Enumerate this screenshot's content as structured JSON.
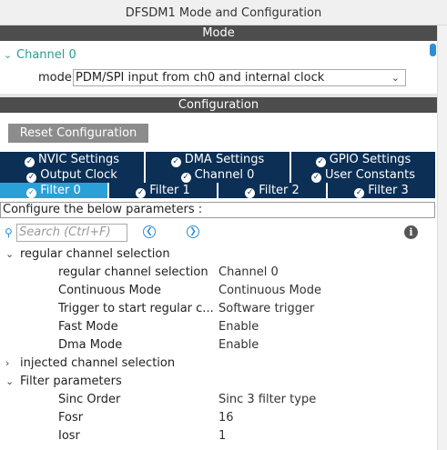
{
  "window": {
    "title": "DFSDM1 Mode and Configuration"
  },
  "mode_section": {
    "header": "Mode",
    "channel_label": "Channel 0",
    "mode_label": "mode",
    "mode_value": "PDM/SPI input from ch0 and internal clock"
  },
  "config_section": {
    "header": "Configuration",
    "reset_button": "Reset Configuration"
  },
  "tabs": {
    "row1": [
      "NVIC Settings",
      "DMA Settings",
      "GPIO Settings"
    ],
    "row2": [
      "Output Clock",
      "Channel 0",
      "User Constants"
    ],
    "row3": [
      "Filter 0",
      "Filter 1",
      "Filter 2",
      "Filter 3"
    ],
    "active": "Filter 0"
  },
  "configure_text": "Configure the below parameters :",
  "search": {
    "placeholder": "Search (Ctrl+F)"
  },
  "icons": {
    "search": "search-icon",
    "prev": "chevron-left-icon",
    "next": "chevron-right-icon",
    "info": "info-icon",
    "check": "check-icon"
  },
  "colors": {
    "tab_bg": "#0b2f55",
    "tab_active": "#2aa0d8",
    "section_bar": "#4d4d4d",
    "channel_text": "#2a9d8f"
  },
  "tree": {
    "regular": {
      "label": "regular channel selection",
      "params": [
        {
          "name": "regular channel selection",
          "value": "Channel 0"
        },
        {
          "name": "Continuous Mode",
          "value": "Continuous Mode"
        },
        {
          "name": "Trigger to start regular c...",
          "value": "Software trigger"
        },
        {
          "name": "Fast Mode",
          "value": "Enable"
        },
        {
          "name": "Dma Mode",
          "value": "Enable"
        }
      ]
    },
    "injected": {
      "label": "injected channel selection"
    },
    "filter": {
      "label": "Filter parameters",
      "params": [
        {
          "name": "Sinc Order",
          "value": "Sinc 3 filter type"
        },
        {
          "name": "Fosr",
          "value": "16"
        },
        {
          "name": "Iosr",
          "value": "1"
        }
      ]
    }
  }
}
